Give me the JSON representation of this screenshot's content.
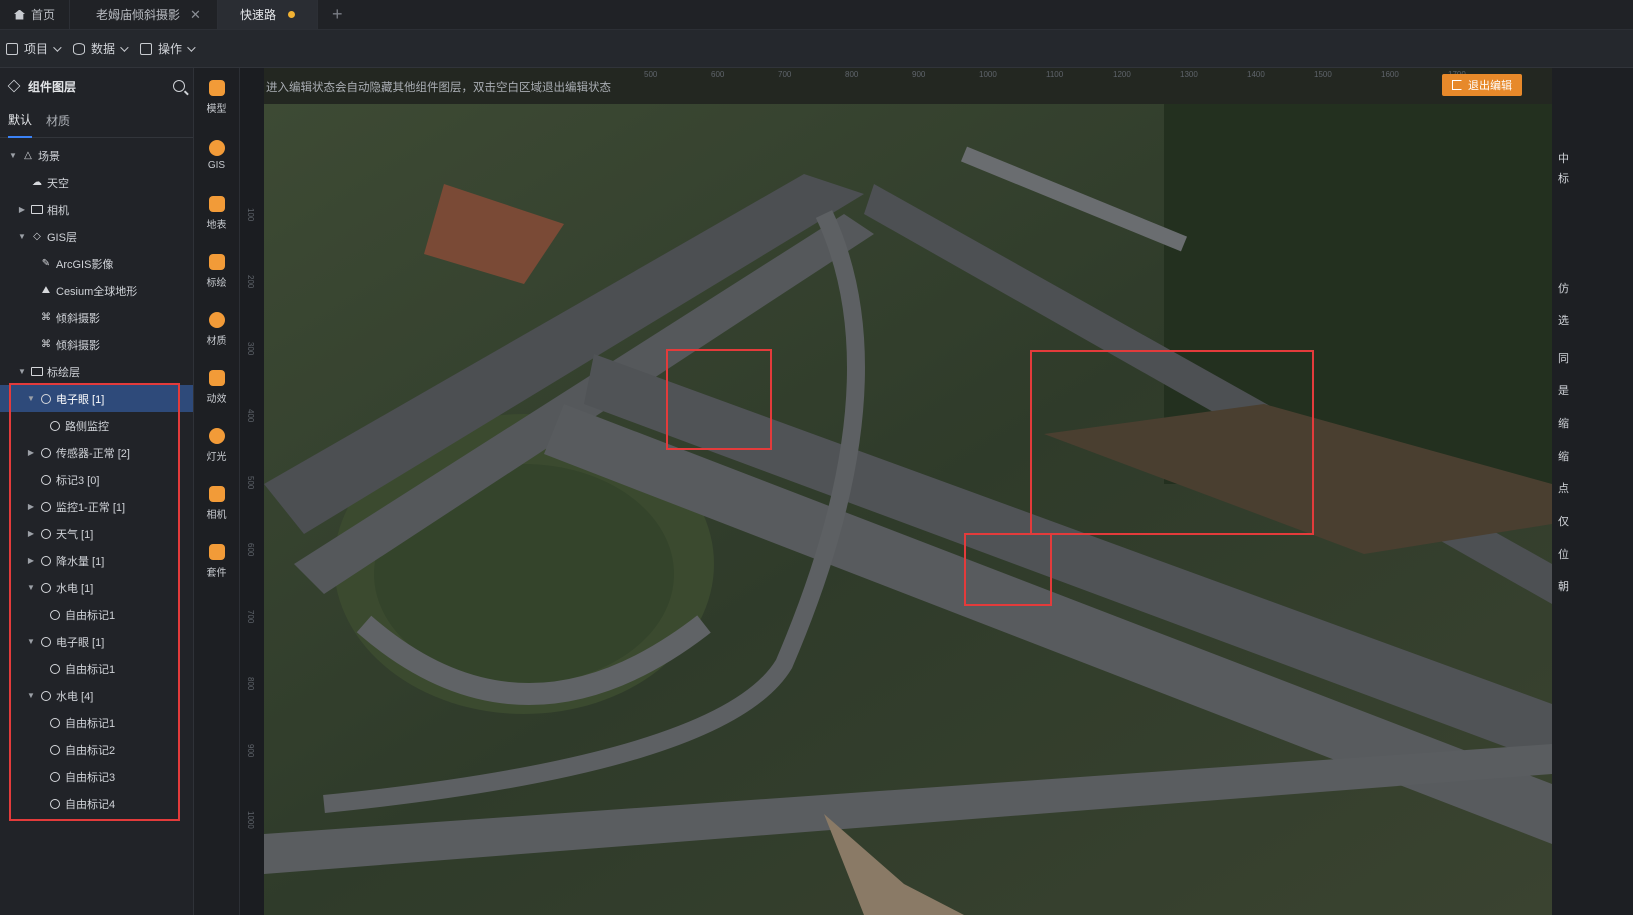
{
  "tabs": [
    {
      "label": "首页",
      "icon": "home-icon"
    },
    {
      "label": "老姆庙倾斜摄影",
      "closable": true
    },
    {
      "label": "快速路",
      "unsaved": true
    }
  ],
  "menubar": [
    "项目",
    "数据",
    "操作"
  ],
  "sidebar": {
    "title": "组件图层",
    "tabs": [
      "默认",
      "材质"
    ],
    "tree": [
      {
        "label": "场景",
        "level": 0,
        "caret": "down",
        "icon": "scene"
      },
      {
        "label": "天空",
        "level": 1,
        "caret": "",
        "icon": "sky"
      },
      {
        "label": "相机",
        "level": 1,
        "caret": "right",
        "icon": "folder"
      },
      {
        "label": "GIS层",
        "level": 1,
        "caret": "down",
        "icon": "gis"
      },
      {
        "label": "ArcGIS影像",
        "level": 2,
        "caret": "",
        "icon": "arcgis"
      },
      {
        "label": "Cesium全球地形",
        "level": 2,
        "caret": "",
        "icon": "terrain"
      },
      {
        "label": "倾斜摄影",
        "level": 2,
        "caret": "",
        "icon": "oblique"
      },
      {
        "label": "倾斜摄影",
        "level": 2,
        "caret": "",
        "icon": "oblique"
      },
      {
        "label": "标绘层",
        "level": 1,
        "caret": "down",
        "icon": "folder"
      },
      {
        "label": "电子眼 [1]",
        "level": 2,
        "caret": "down",
        "icon": "pin",
        "selected": true
      },
      {
        "label": "路侧监控",
        "level": 3,
        "caret": "",
        "icon": "pin"
      },
      {
        "label": "传感器-正常 [2]",
        "level": 2,
        "caret": "right",
        "icon": "pin"
      },
      {
        "label": "标记3 [0]",
        "level": 2,
        "caret": "",
        "icon": "pin"
      },
      {
        "label": "监控1-正常 [1]",
        "level": 2,
        "caret": "right",
        "icon": "pin"
      },
      {
        "label": "天气 [1]",
        "level": 2,
        "caret": "right",
        "icon": "pin"
      },
      {
        "label": "降水量 [1]",
        "level": 2,
        "caret": "right",
        "icon": "pin"
      },
      {
        "label": "水电 [1]",
        "level": 2,
        "caret": "down",
        "icon": "pin"
      },
      {
        "label": "自由标记1",
        "level": 3,
        "caret": "",
        "icon": "pin"
      },
      {
        "label": "电子眼 [1]",
        "level": 2,
        "caret": "down",
        "icon": "pin"
      },
      {
        "label": "自由标记1",
        "level": 3,
        "caret": "",
        "icon": "pin"
      },
      {
        "label": "水电 [4]",
        "level": 2,
        "caret": "down",
        "icon": "pin"
      },
      {
        "label": "自由标记1",
        "level": 3,
        "caret": "",
        "icon": "pin"
      },
      {
        "label": "自由标记2",
        "level": 3,
        "caret": "",
        "icon": "pin"
      },
      {
        "label": "自由标记3",
        "level": 3,
        "caret": "",
        "icon": "pin"
      },
      {
        "label": "自由标记4",
        "level": 3,
        "caret": "",
        "icon": "pin"
      }
    ]
  },
  "tools": [
    "模型",
    "GIS",
    "地表",
    "标绘",
    "材质",
    "动效",
    "灯光",
    "相机",
    "套件"
  ],
  "viewport": {
    "hint": "进入编辑状态会自动隐藏其他组件图层，双击空白区域退出编辑状态",
    "exit_label": "退出编辑",
    "ruler_top": [
      "500",
      "600",
      "700",
      "800",
      "900",
      "1000",
      "1100",
      "1200",
      "1300",
      "1400",
      "1500",
      "1600",
      "1700"
    ],
    "ruler_left": [
      "100",
      "200",
      "300",
      "400",
      "500",
      "600",
      "700",
      "800",
      "900",
      "1000"
    ]
  },
  "right_panel_chars": [
    "中",
    "标",
    "仿",
    "选",
    "同",
    "是",
    "缩",
    "缩",
    "点",
    "仅",
    "位",
    "朝"
  ],
  "colors": {
    "accent": "#e7892a",
    "selection": "#2e4a7a",
    "highlight_box": "#e33b3b"
  }
}
